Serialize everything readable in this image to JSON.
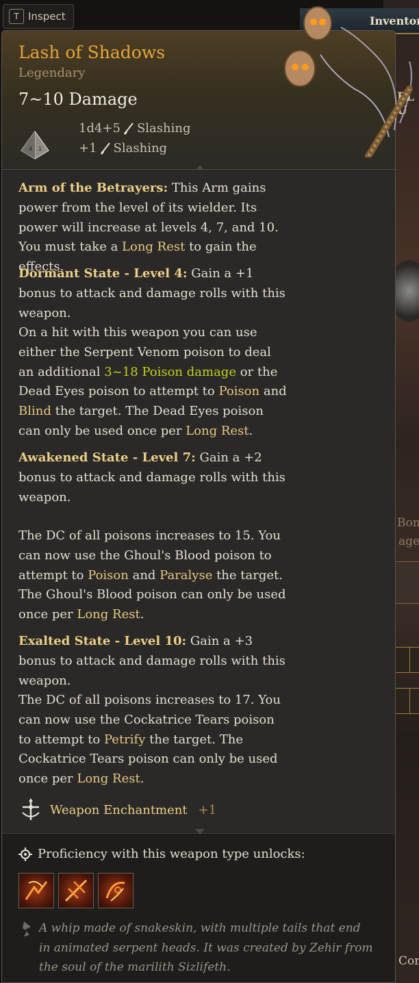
{
  "inspect": {
    "key": "T",
    "label": "Inspect"
  },
  "background": {
    "inventory_label": "Inventory",
    "side_text_1": "EL U",
    "side_text_2": "Bonu",
    "side_text_3": "age",
    "side_text_4": "Con"
  },
  "item": {
    "name": "Lash of Shadows",
    "rarity": "Legendary",
    "damage": "7~10 Damage",
    "damage_lines": [
      {
        "dice": "1d4+5",
        "type": "Slashing"
      },
      {
        "dice": "+1",
        "type": "Slashing"
      }
    ]
  },
  "description": {
    "p1_title": "Arm of the Betrayers:",
    "p1_a": " This Arm gains power from the level of its wielder. Its power will increase at levels 4, 7, and 10. You must take a ",
    "p1_kw": "Long Rest",
    "p1_b": " to gain the effects.",
    "p2_title": "Dormant State - Level 4:",
    "p2_a": " Gain a +1 bonus to attack and damage rolls with this weapon.",
    "p3_a": "On a hit with this weapon you can use either the Serpent Venom poison to deal an additional ",
    "p3_poison": "3~18 Poison damage",
    "p3_b": " or the Dead Eyes poison to attempt to ",
    "p3_kw1": "Poison",
    "p3_c": " and ",
    "p3_kw2": "Blind",
    "p3_d": " the target. The Dead Eyes poison can only be used once per ",
    "p3_kw3": "Long Rest",
    "p3_e": ".",
    "p4_title": "Awakened State - Level 7:",
    "p4_a": " Gain a +2 bonus to attack and damage rolls with this weapon.",
    "p5_a": "The DC of all poisons increases to 15. You can now use the Ghoul's Blood poison to attempt to ",
    "p5_kw1": "Poison",
    "p5_b": " and ",
    "p5_kw2": "Paralyse",
    "p5_c": " the target. The Ghoul's Blood poison can only be used once per ",
    "p5_kw3": "Long Rest",
    "p5_d": ".",
    "p6_title": "Exalted State - Level 10:",
    "p6_a": " Gain a +3 bonus to attack and damage rolls with this weapon.",
    "p7_a": "The DC of all poisons increases to 17. You can now use the Cockatrice Tears poison to attempt to ",
    "p7_kw1": "Petrify",
    "p7_b": " the target. The Cockatrice Tears poison can only be used once per ",
    "p7_kw2": "Long Rest",
    "p7_c": "."
  },
  "enchantment": {
    "label": "Weapon Enchantment",
    "value": "+1"
  },
  "proficiency": {
    "label": "Proficiency with this weapon type unlocks:",
    "icons": [
      "lacerate-icon",
      "flourish-icon",
      "cleave-icon"
    ]
  },
  "flavor": "A whip made of snakeskin, with multiple tails that end in animated serpent heads. It was created by Zehir from the soul of the marilith Sizlifeth.",
  "colors": {
    "item_name": "#e6a43a",
    "highlight": "#ecd089",
    "keyword": "#e6c884",
    "poison": "#c2d21a"
  }
}
